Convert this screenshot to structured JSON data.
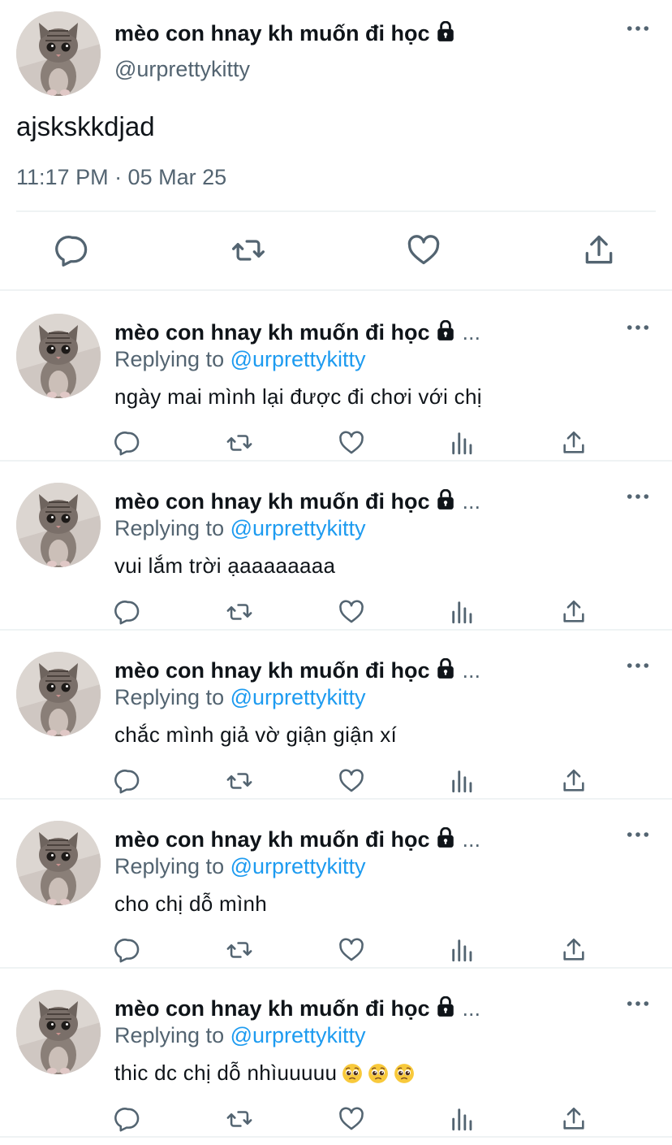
{
  "main_tweet": {
    "display_name": "mèo con hnay kh muốn đi học",
    "handle": "@urprettykitty",
    "text": "ajskskkdjad",
    "timestamp": "11:17 PM · 05 Mar 25",
    "actions": [
      "reply-icon",
      "retweet-icon",
      "like-icon",
      "share-icon"
    ]
  },
  "reply_prefix": "Replying to",
  "truncation": "...",
  "replies": [
    {
      "display_name": "mèo con hnay kh muốn đi học",
      "replying_to": "@urprettykitty",
      "text": "ngày mai mình lại được đi chơi với chị"
    },
    {
      "display_name": "mèo con hnay kh muốn đi học",
      "replying_to": "@urprettykitty",
      "text": "vui lắm trời ạaaaaaaaa"
    },
    {
      "display_name": "mèo con hnay kh muốn đi học",
      "replying_to": "@urprettykitty",
      "text": "chắc mình giả vờ giận giận xí"
    },
    {
      "display_name": "mèo con hnay kh muốn đi học",
      "replying_to": "@urprettykitty",
      "text": "cho chị dỗ mình"
    },
    {
      "display_name": "mèo con hnay kh muốn đi học",
      "replying_to": "@urprettykitty",
      "text": "thic dc chị dỗ nhìuuuuu",
      "emojis": [
        "pleading-face-emoji",
        "pleading-face-emoji",
        "pleading-face-emoji"
      ]
    }
  ],
  "reply_actions": [
    "reply-icon",
    "retweet-icon",
    "like-icon",
    "views-icon",
    "share-icon"
  ],
  "colors": {
    "text": "#0f1419",
    "secondary": "#536471",
    "link": "#1d9bf0",
    "divider": "#eff3f4"
  }
}
